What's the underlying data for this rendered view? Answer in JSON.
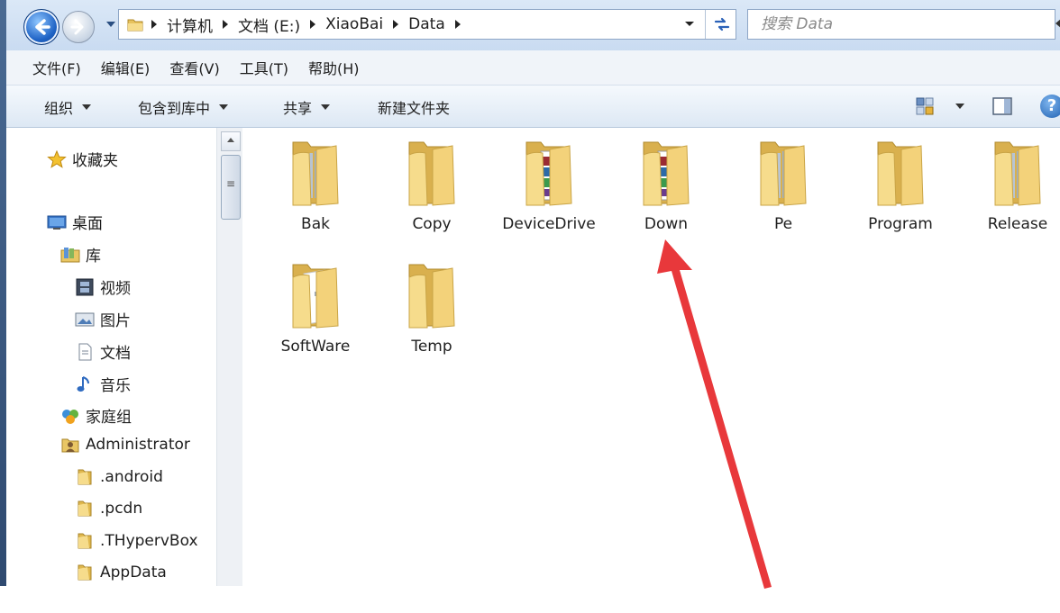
{
  "address": {
    "crumbs": [
      "计算机",
      "文档 (E:)",
      "XiaoBai",
      "Data"
    ],
    "search_placeholder": "搜索 Data"
  },
  "menu": [
    "文件(F)",
    "编辑(E)",
    "查看(V)",
    "工具(T)",
    "帮助(H)"
  ],
  "toolbar": {
    "organize": "组织",
    "include_library": "包含到库中",
    "share": "共享",
    "new_folder": "新建文件夹"
  },
  "nav": {
    "favorites": "收藏夹",
    "desktop": "桌面",
    "libraries": "库",
    "videos": "视频",
    "pictures": "图片",
    "documents": "文档",
    "music": "音乐",
    "homegroup": "家庭组",
    "administrator": "Administrator",
    "folders": [
      ".android",
      ".pcdn",
      ".THypervBox",
      "AppData"
    ]
  },
  "files": [
    {
      "name": "Bak",
      "kind": "folder-docs"
    },
    {
      "name": "Copy",
      "kind": "folder-plain"
    },
    {
      "name": "DeviceDrive",
      "kind": "folder-archive"
    },
    {
      "name": "Down",
      "kind": "folder-archive"
    },
    {
      "name": "Pe",
      "kind": "folder-docs"
    },
    {
      "name": "Program",
      "kind": "folder-plain"
    },
    {
      "name": "Release",
      "kind": "folder-docs"
    },
    {
      "name": "SoftWare",
      "kind": "folder-page"
    },
    {
      "name": "Temp",
      "kind": "folder-plain"
    }
  ],
  "colors": {
    "accent_arrow": "#e8383b",
    "folder_light": "#f6dc8c",
    "folder_dark": "#d9b04e",
    "window_bar": "#dbe8f7"
  }
}
